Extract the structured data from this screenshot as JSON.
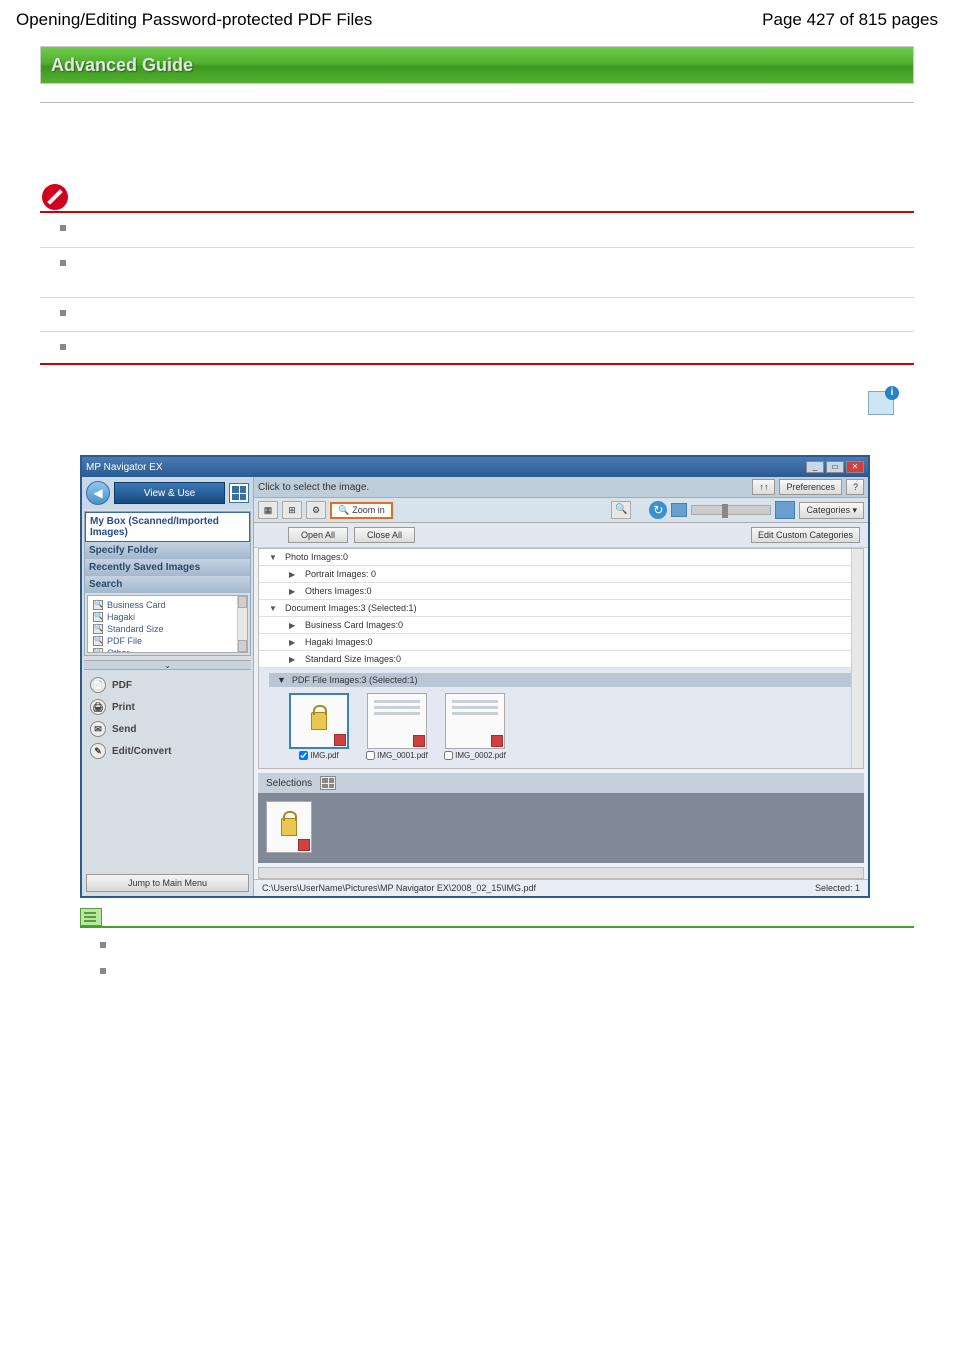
{
  "header": {
    "title_left": "Opening/Editing Password-protected PDF Files",
    "title_right": "Page 427 of 815 pages"
  },
  "advanced_guide_label": "Advanced Guide",
  "app": {
    "title": "MP Navigator EX",
    "click_select_label": "Click to select the image.",
    "sort_label": "↑↑",
    "prefs_label": "Preferences",
    "help_label": "?",
    "zoom_in_label": "Zoom in",
    "categories_label": "Categories",
    "open_all_label": "Open All",
    "close_all_label": "Close All",
    "edit_categories_label": "Edit Custom Categories",
    "sidebar": {
      "view_use_label": "View & Use",
      "mybox_label": "My Box (Scanned/Imported Images)",
      "specify_folder_label": "Specify Folder",
      "recently_saved_label": "Recently Saved Images",
      "search_label": "Search",
      "tree": {
        "business_card": "Business Card",
        "hagaki": "Hagaki",
        "standard_size": "Standard Size",
        "pdf_file": "PDF File",
        "other": "Other"
      },
      "actions": {
        "pdf": "PDF",
        "print": "Print",
        "send": "Send",
        "edit_convert": "Edit/Convert"
      },
      "jump_label": "Jump to Main Menu"
    },
    "categories_list": {
      "photo": "Photo   Images:0",
      "portrait": "Portrait   Images: 0",
      "others": "Others   Images:0",
      "document": "Document   Images:3   (Selected:1)",
      "business_card": "Business Card   Images:0",
      "hagaki": "Hagaki   Images:0",
      "standard_size": "Standard Size   Images:0",
      "pdf_file_hdr": "PDF File   Images:3   (Selected:1)"
    },
    "thumbs": {
      "f1": "IMG.pdf",
      "f2": "IMG_0001.pdf",
      "f3": "IMG_0002.pdf"
    },
    "selections_label": "Selections",
    "status_path": "C:\\Users\\UserName\\Pictures\\MP Navigator EX\\2008_02_15\\IMG.pdf",
    "status_selected": "Selected: 1"
  }
}
